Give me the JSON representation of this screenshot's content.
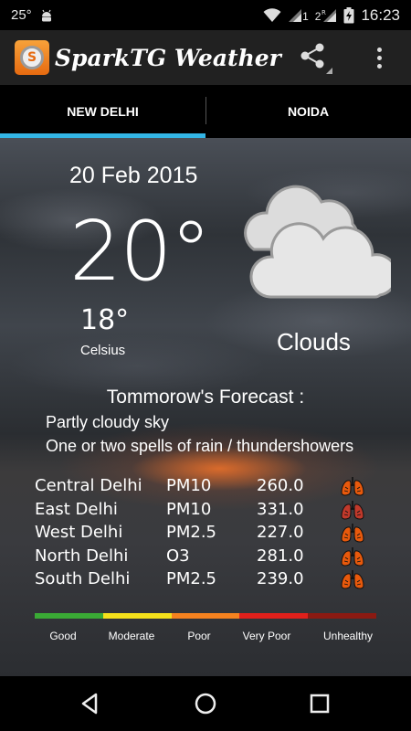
{
  "status_bar": {
    "temperature": "25°",
    "sim1_label": "1",
    "sim2_label": "2",
    "roaming": "R",
    "time": "16:23"
  },
  "app": {
    "title": "SparkTG Weather",
    "logo_letter": "S"
  },
  "tabs": [
    {
      "label": "NEW DELHI",
      "active": true
    },
    {
      "label": "NOIDA",
      "active": false
    }
  ],
  "weather": {
    "date": "20 Feb 2015",
    "temperature": "20°",
    "min_temperature": "18°",
    "unit": "Celsius",
    "condition": "Clouds",
    "icon": "clouds-icon"
  },
  "forecast": {
    "title": "Tommorow's  Forecast :",
    "lines": [
      "Partly cloudy sky",
      "One or two spells of rain /  thundershowers"
    ]
  },
  "air_quality": [
    {
      "region": "Central Delhi",
      "pollutant": "PM10",
      "value": "260.0",
      "icon": "lungs-icon",
      "color": "#e8590c"
    },
    {
      "region": "East Delhi",
      "pollutant": "PM10",
      "value": "331.0",
      "icon": "lungs-icon",
      "color": "#c0392b"
    },
    {
      "region": "West Delhi",
      "pollutant": "PM2.5",
      "value": "227.0",
      "icon": "lungs-icon",
      "color": "#e8590c"
    },
    {
      "region": "North Delhi",
      "pollutant": "O3",
      "value": "281.0",
      "icon": "lungs-icon",
      "color": "#e8590c"
    },
    {
      "region": "South Delhi",
      "pollutant": "PM2.5",
      "value": "239.0",
      "icon": "lungs-icon",
      "color": "#e8590c"
    }
  ],
  "aqi_scale": [
    {
      "label": "Good",
      "color": "#3aaa35"
    },
    {
      "label": "Moderate",
      "color": "#f4e11b"
    },
    {
      "label": "Poor",
      "color": "#f5821f"
    },
    {
      "label": "Very Poor",
      "color": "#e0201b"
    },
    {
      "label": "Unhealthy",
      "color": "#8b1a12"
    }
  ],
  "colors": {
    "accent": "#33b5e5",
    "app_bar": "#212121"
  }
}
